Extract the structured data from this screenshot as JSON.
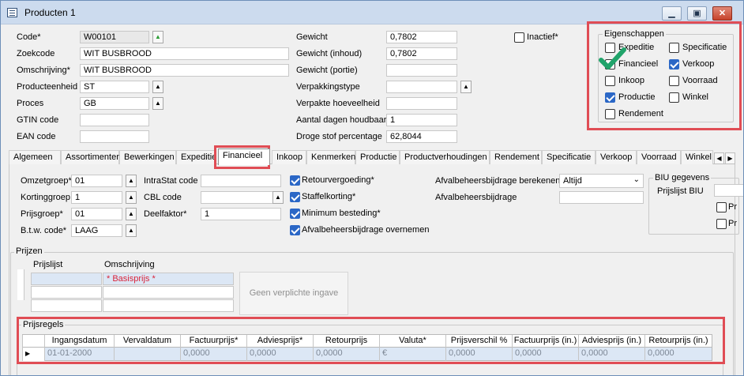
{
  "window": {
    "title": "Producten 1",
    "minimize": "▁",
    "restore": "▣",
    "close": "✕"
  },
  "header": {
    "code_label": "Code*",
    "code_value": "W00101",
    "zoekcode_label": "Zoekcode",
    "zoekcode_value": "WIT BUSBROOD",
    "omschrijving_label": "Omschrijving*",
    "omschrijving_value": "WIT BUSBROOD",
    "producteenheid_label": "Producteenheid",
    "producteenheid_value": "ST",
    "proces_label": "Proces",
    "proces_value": "GB",
    "gtin_label": "GTIN code",
    "gtin_value": "",
    "ean_label": "EAN code",
    "ean_value": "",
    "gewicht_label": "Gewicht",
    "gewicht_value": "0,7802",
    "gewicht_inhoud_label": "Gewicht (inhoud)",
    "gewicht_inhoud_value": "0,7802",
    "gewicht_portie_label": "Gewicht (portie)",
    "gewicht_portie_value": "",
    "verpakkingstype_label": "Verpakkingstype",
    "verpakkingstype_value": "",
    "verpakte_hoeveelheid_label": "Verpakte hoeveelheid",
    "verpakte_hoeveelheid_value": "",
    "houdbaar_label": "Aantal dagen houdbaar",
    "houdbaar_value": "1",
    "droge_stof_label": "Droge stof percentage",
    "droge_stof_value": "62,8044",
    "inactief_label": "Inactief*"
  },
  "eigenschappen": {
    "title": "Eigenschappen",
    "items": [
      {
        "label": "Expeditie",
        "checked": false
      },
      {
        "label": "Specificatie",
        "checked": false
      },
      {
        "label": "Financieel",
        "checked": false
      },
      {
        "label": "Verkoop",
        "checked": true
      },
      {
        "label": "Inkoop",
        "checked": false
      },
      {
        "label": "Voorraad",
        "checked": false
      },
      {
        "label": "Productie",
        "checked": true
      },
      {
        "label": "Winkel",
        "checked": false
      },
      {
        "label": "Rendement",
        "checked": false
      }
    ]
  },
  "tabs": [
    "Algemeen",
    "Assortimenten",
    "Bewerkingen",
    "Expeditie",
    "Financieel",
    "Inkoop",
    "Kenmerken",
    "Productie",
    "Productverhoudingen",
    "Rendement",
    "Specificatie",
    "Verkoop",
    "Voorraad",
    "Winkel"
  ],
  "financieel": {
    "omzetgroep_label": "Omzetgroep*",
    "omzetgroep_value": "01",
    "kortinggroep_label": "Kortinggroep",
    "kortinggroep_value": "1",
    "prijsgroep_label": "Prijsgroep*",
    "prijsgroep_value": "01",
    "btw_label": "B.t.w. code*",
    "btw_value": "LAAG",
    "intrastat_label": "IntraStat code",
    "intrastat_value": "",
    "cbl_label": "CBL code",
    "cbl_value": "",
    "deelfaktor_label": "Deelfaktor*",
    "deelfaktor_value": "1",
    "retourvergoeding_label": "Retourvergoeding*",
    "staffelkorting_label": "Staffelkorting*",
    "minimum_label": "Minimum besteding*",
    "afval_overnemen_label": "Afvalbeheersbijdrage overnemen",
    "afval_berekenen_label": "Afvalbeheersbijdrage berekenen",
    "afval_berekenen_value": "Altijd",
    "afval_label": "Afvalbeheersbijdrage",
    "afval_value": "",
    "biu_title": "BIU gegevens",
    "prijslijst_biu_label": "Prijslijst BIU"
  },
  "prijzen": {
    "title": "Prijzen",
    "col_prijslijst": "Prijslijst",
    "col_omschrijving": "Omschrijving",
    "row1_omschrijving": "* Basisprijs *",
    "button": "Geen verplichte ingave"
  },
  "prijsregels": {
    "title": "Prijsregels",
    "columns": [
      "Ingangsdatum",
      "Vervaldatum",
      "Factuurprijs*",
      "Adviesprijs*",
      "Retourprijs",
      "Valuta*",
      "Prijsverschil %",
      "Factuurprijs (in.)",
      "Adviesprijs (in.)",
      "Retourprijs (in.)"
    ],
    "row": [
      "01-01-2000",
      "",
      "0,0000",
      "0,0000",
      "0,0000",
      "€",
      "0,0000",
      "0,0000",
      "0,0000",
      "0,0000"
    ]
  },
  "colors": {
    "highlight": "#e04d55",
    "checkbox": "#2b67c6",
    "row_selection": "#dce7f5"
  }
}
